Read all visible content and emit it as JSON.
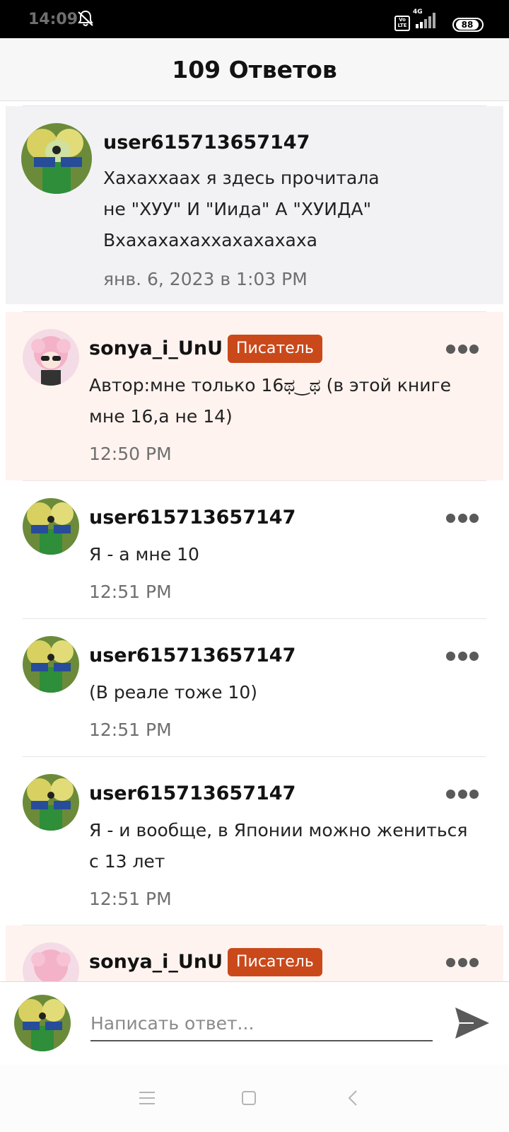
{
  "status_bar": {
    "time": "14:09",
    "network": "4G",
    "volte": "Vo LTE",
    "battery": "88"
  },
  "header": {
    "title": "109 Ответов"
  },
  "comments": [
    {
      "username": "user615713657147",
      "text_lines": [
        "Хахаххаах я здесь прочитала",
        "не \"ХУУ\" И \"Иида\" А \"ХУИДА\"",
        "Вхахахахаххахахахаха"
      ],
      "time": "янв. 6, 2023 в 1:03 PM",
      "highlight": "original"
    },
    {
      "username": "sonya_i_UnU",
      "badge": "Писатель",
      "text_lines": [
        "Автор:мне только 16ಥ‿ಥ (в этой книге",
        "мне 16,а не 14)"
      ],
      "time": "12:50 PM",
      "highlight": "author"
    },
    {
      "username": "user615713657147",
      "text_lines": [
        "Я - а мне 10"
      ],
      "time": "12:51 PM"
    },
    {
      "username": "user615713657147",
      "text_lines": [
        "(В реале тоже 10)"
      ],
      "time": "12:51 PM"
    },
    {
      "username": "user615713657147",
      "text_lines": [
        "Я - и вообще, в Японии можно жениться",
        "с 13 лет"
      ],
      "time": "12:51 PM"
    },
    {
      "username": "sonya_i_UnU",
      "badge": "Писатель",
      "highlight": "author"
    }
  ],
  "reply": {
    "placeholder": "Написать ответ..."
  },
  "colors": {
    "author_bg": "#fff3ef",
    "original_bg": "#f2f2f4",
    "badge_bg": "#c9491b",
    "time_text": "#6f6f6f"
  },
  "icons": {
    "more": "more-options-icon",
    "send": "send-icon",
    "dnd": "bell-off-icon"
  }
}
